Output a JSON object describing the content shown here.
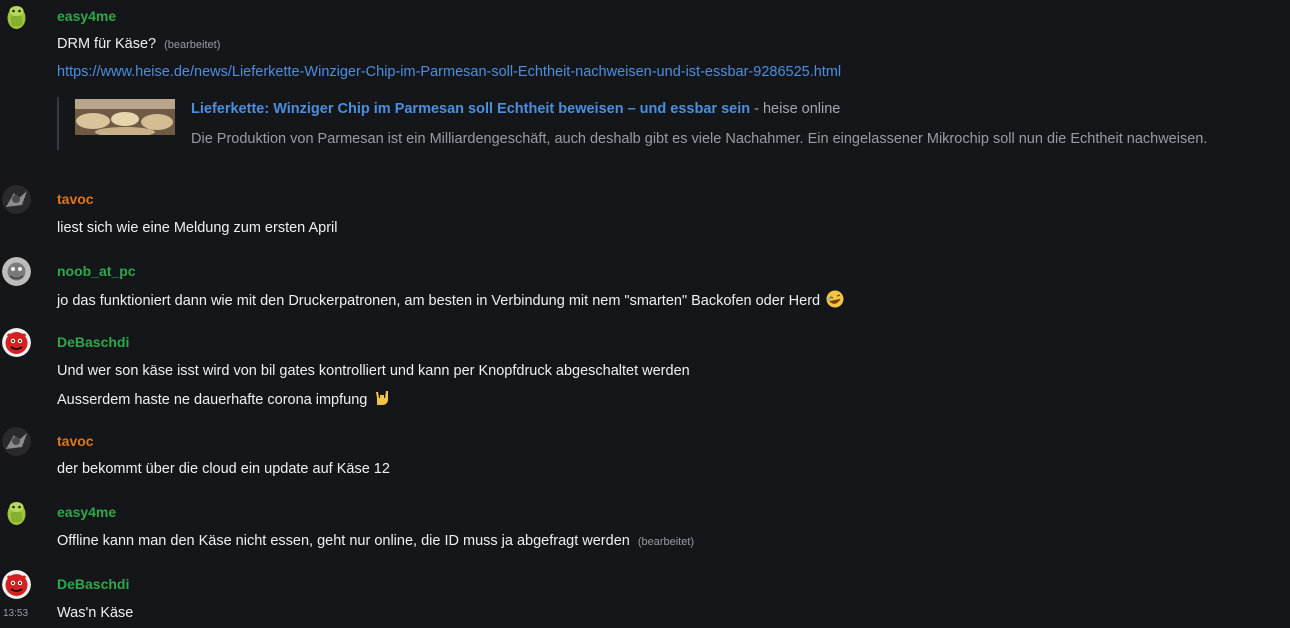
{
  "colors": {
    "background": "#15161a",
    "author_green": "#2ea84a",
    "author_orange": "#e0751b",
    "link": "#4a8fe0",
    "muted": "#9a9ba0"
  },
  "messages": [
    {
      "author": "easy4me",
      "avatar_icon": "android-avatar-icon",
      "text": "DRM für Käse?",
      "edited": "(bearbeitet)",
      "link": "https://www.heise.de/news/Lieferkette-Winziger-Chip-im-Parmesan-soll-Echtheit-nachweisen-und-ist-essbar-9286525.html",
      "embed": {
        "title": "Lieferkette: Winziger Chip im Parmesan soll Echtheit beweisen – und essbar sein",
        "site": " - heise online",
        "description": "Die Produktion von Parmesan ist ein Milliardengeschäft, auch deshalb gibt es viele Nachahmer. Ein eingelassener Mikrochip soll nun die Echtheit nachweisen."
      }
    },
    {
      "author": "tavoc",
      "avatar_icon": "dark-bird-avatar-icon",
      "text": "liest sich wie eine Meldung zum ersten April"
    },
    {
      "author": "noob_at_pc",
      "avatar_icon": "grey-creature-avatar-icon",
      "text": "jo das funktioniert dann wie mit den Druckerpatronen, am besten in Verbindung mit nem \"smarten\" Backofen oder Herd",
      "emoji": "rolling-on-floor-laughing-emoji"
    },
    {
      "author": "DeBaschdi",
      "avatar_icon": "red-devil-avatar-icon",
      "text": "Und wer son käse isst wird von bil gates kontrolliert und kann per Knopfdruck abgeschaltet werden",
      "text2": "Ausserdem haste ne dauerhafte corona impfung",
      "emoji": "rock-hand-emoji"
    },
    {
      "author": "tavoc",
      "avatar_icon": "dark-bird-avatar-icon",
      "text": "der bekommt über die cloud ein update auf Käse 12"
    },
    {
      "author": "easy4me",
      "avatar_icon": "android-avatar-icon",
      "text": "Offline kann man den Käse nicht essen, geht nur online, die ID muss ja abgefragt werden",
      "edited": "(bearbeitet)"
    },
    {
      "author": "DeBaschdi",
      "avatar_icon": "red-devil-avatar-icon",
      "text": "Was'n Käse",
      "time": "13:53"
    }
  ]
}
